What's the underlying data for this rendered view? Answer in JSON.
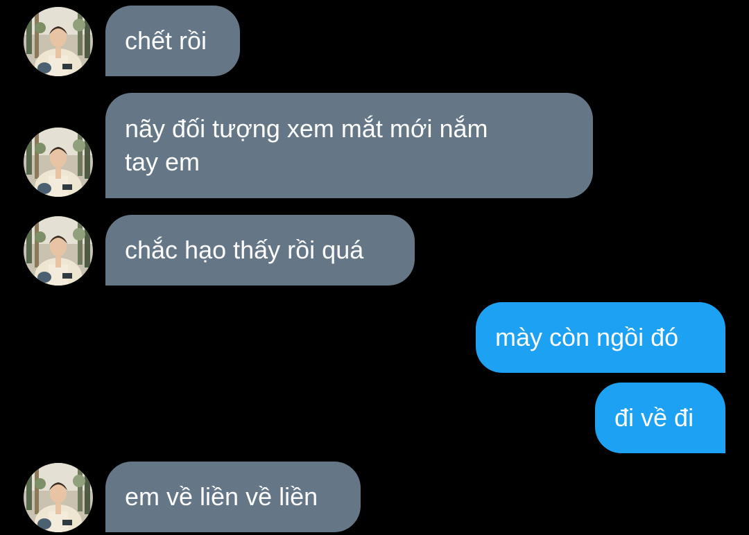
{
  "colors": {
    "background": "#000000",
    "incoming_bubble": "#657786",
    "outgoing_bubble": "#1da1f2",
    "text": "#ffffff"
  },
  "contact": {
    "avatar_icon": "profile-photo-avatar"
  },
  "messages": [
    {
      "direction": "incoming",
      "text": "chết rồi"
    },
    {
      "direction": "incoming",
      "text": "nãy đối tượng xem mắt mới nắm\ntay em"
    },
    {
      "direction": "incoming",
      "text": "chắc hạo thấy rồi quá"
    },
    {
      "direction": "outgoing",
      "text": "mày còn ngồi đó"
    },
    {
      "direction": "outgoing",
      "text": "đi về đi"
    },
    {
      "direction": "incoming",
      "text": "em về liền về liền"
    }
  ]
}
